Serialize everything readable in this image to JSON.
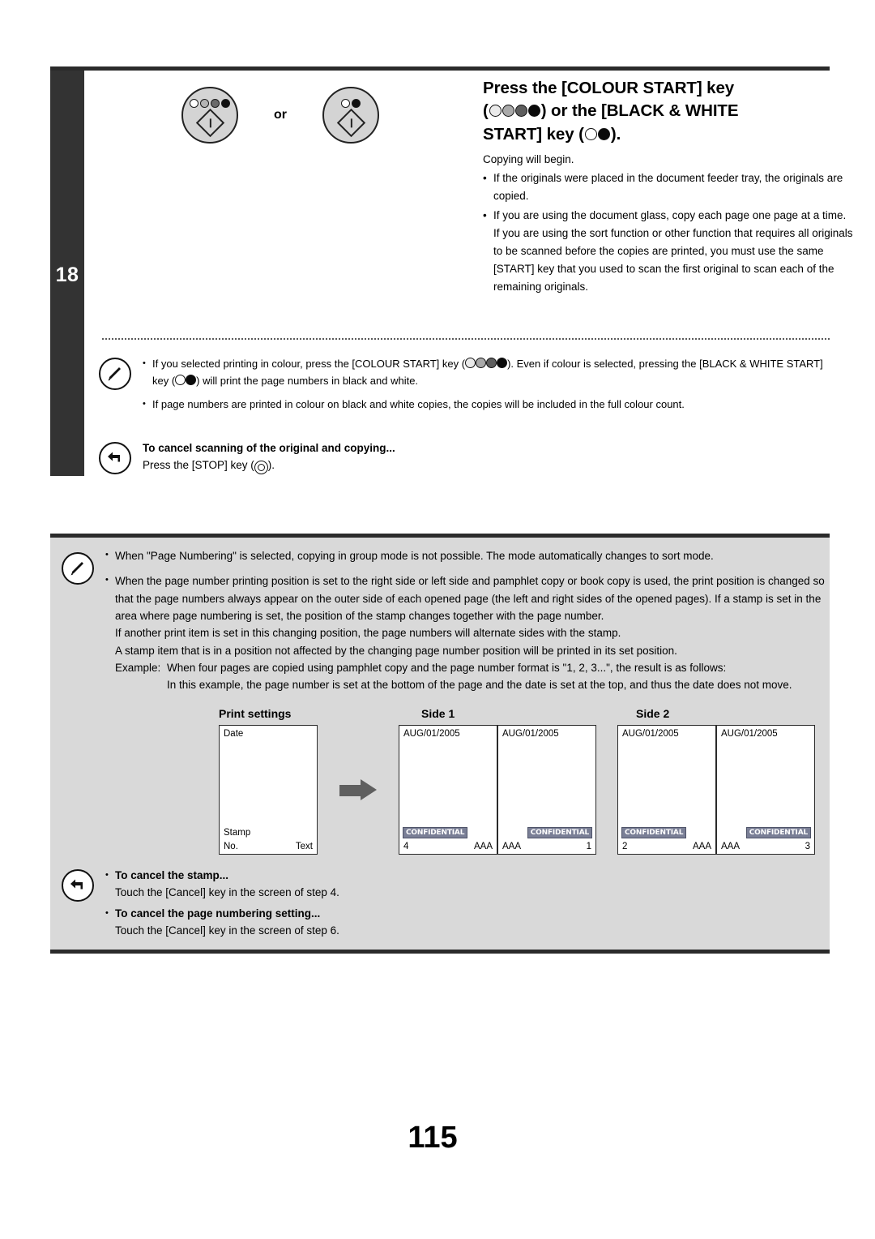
{
  "step": {
    "number": "18",
    "title_part1": "Press the [COLOUR START] key",
    "title_part2": ") or the [BLACK & WHITE",
    "title_part3": "START] key (",
    "title_part4": ").",
    "title_open_paren": "(",
    "lead": "Copying will begin.",
    "bullets": [
      "If the originals were placed in the document feeder tray, the originals are copied.",
      "If you are using the document glass, copy each page one page at a time."
    ],
    "continuation": "If you are using the sort function or other function that requires all originals to be scanned before the copies are printed, you must use the same [START] key that you used to scan the first original to scan each of the remaining originals.",
    "or_label": "or",
    "key_colour_name": "colour-start-key",
    "key_bw_name": "black-white-start-key"
  },
  "notes_white": {
    "icon": "pencil-note-icon",
    "bullet1_a": "If you selected printing in colour, press the [COLOUR START] key (",
    "bullet1_b": "). Even if colour is selected, pressing the [BLACK & WHITE START] key (",
    "bullet1_c": ") will print the page numbers in black and white.",
    "bullet2": "If page numbers are printed in colour on black and white copies, the copies will be included in the full colour count.",
    "cancel_icon": "return-arrow-icon",
    "cancel_heading": "To cancel scanning of the original and copying...",
    "cancel_text_a": "Press the [STOP] key (",
    "cancel_text_b": ")."
  },
  "graybox": {
    "icon": "pencil-note-icon",
    "bullet1": "When \"Page Numbering\" is selected, copying in group mode is not possible. The mode automatically changes to sort mode.",
    "bullet2": "When the page number printing position is set to the right side or left side and pamphlet copy or book copy is used, the print position is changed so that the page numbers always appear on the outer side of each opened page (the left and right sides of the opened pages). If a stamp is set in the area where page numbering is set, the position of the stamp changes together with the page number.",
    "sub1": "If another print item is set in this changing position, the page numbers will alternate sides with the stamp.",
    "sub2": "A stamp item that is in a position not affected by the changing page number position will be printed in its set position.",
    "example_label": "Example:",
    "example_text": "When four pages are copied using pamphlet copy and the page number format is \"1, 2, 3...\", the result is as follows:",
    "example_note": "In this example, the page number is set at the bottom of the page and the date is set at the top, and thus the date does not move."
  },
  "diagram": {
    "heading_print_settings": "Print settings",
    "heading_side1": "Side 1",
    "heading_side2": "Side 2",
    "settings_sheet": {
      "date_label": "Date",
      "stamp_label": "Stamp",
      "no_label": "No.",
      "text_label": "Text"
    },
    "date_value": "AUG/01/2005",
    "stamp_value": "CONFIDENTIAL",
    "text_value": "AAA",
    "side1": [
      {
        "date": "AUG/01/2005",
        "stamp": "CONFIDENTIAL",
        "stamp_side": "left",
        "num": "4",
        "num_side": "left",
        "text": "AAA",
        "text_side": "right"
      },
      {
        "date": "AUG/01/2005",
        "stamp": "CONFIDENTIAL",
        "stamp_side": "right",
        "num": "1",
        "num_side": "right",
        "text": "AAA",
        "text_side": "left"
      }
    ],
    "side2": [
      {
        "date": "AUG/01/2005",
        "stamp": "CONFIDENTIAL",
        "stamp_side": "left",
        "num": "2",
        "num_side": "left",
        "text": "AAA",
        "text_side": "right"
      },
      {
        "date": "AUG/01/2005",
        "stamp": "CONFIDENTIAL",
        "stamp_side": "right",
        "num": "3",
        "num_side": "right",
        "text": "AAA",
        "text_side": "left"
      }
    ],
    "arrow_icon": "right-arrow-icon"
  },
  "cancel_box": {
    "icon": "return-arrow-icon",
    "item1_heading": "To cancel the stamp...",
    "item1_text": "Touch the [Cancel] key in the screen of step 4.",
    "item2_heading": "To cancel the page numbering setting...",
    "item2_text": "Touch the [Cancel] key in the screen of step 6."
  },
  "page_number": "115",
  "colors": {
    "dark_bar": "#333333",
    "gray_box": "#d9d9d9",
    "stamp_badge": "#7a7f96",
    "arrow": "#5f5f5f"
  }
}
